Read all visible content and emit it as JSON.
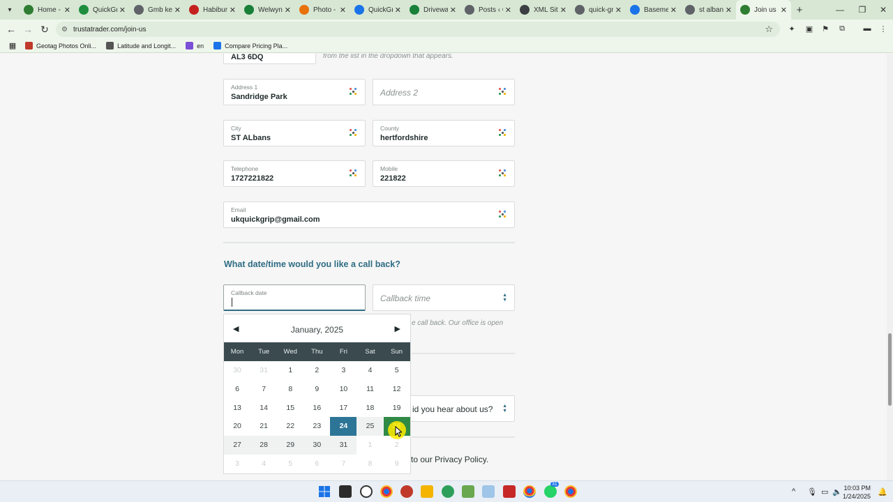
{
  "browser": {
    "tabs": [
      {
        "label": "Home -",
        "color": "#2e7d32"
      },
      {
        "label": "QuickGri",
        "color": "#1e8e3e"
      },
      {
        "label": "Gmb key",
        "color": "#5f6368"
      },
      {
        "label": "Habibur",
        "color": "#c5221f"
      },
      {
        "label": "Welwyn",
        "color": "#188038"
      },
      {
        "label": "Photo -",
        "color": "#e8710a"
      },
      {
        "label": "QuickGri",
        "color": "#1a73e8"
      },
      {
        "label": "Driveway",
        "color": "#188038"
      },
      {
        "label": "Posts ‹ Q",
        "color": "#5f6368"
      },
      {
        "label": "XML Site",
        "color": "#3c4043"
      },
      {
        "label": "quick-gr",
        "color": "#5f6368"
      },
      {
        "label": "Basemen",
        "color": "#1a73e8"
      },
      {
        "label": "st albans",
        "color": "#5f6368"
      },
      {
        "label": "Join us -",
        "color": "#2e7d32",
        "active": true
      }
    ],
    "new_tab": "+",
    "url": "trustatrader.com/join-us",
    "bookmarks": [
      {
        "label": "Geotag Photos Onli...",
        "color": "#c0392b"
      },
      {
        "label": "Latitude and Longit...",
        "color": "#555555"
      },
      {
        "label": "en",
        "color": "#7b4fd6"
      },
      {
        "label": "Compare Pricing Pla...",
        "color": "#1a73e8"
      }
    ]
  },
  "form": {
    "postcode_value": "AL3 6DQ",
    "postcode_hint": "from the list in the dropdown that appears.",
    "address1": {
      "label": "Address 1",
      "value": "Sandridge Park"
    },
    "address2": {
      "placeholder": "Address 2"
    },
    "city": {
      "label": "City",
      "value": "ST ALbans"
    },
    "county": {
      "label": "County",
      "value": "hertfordshire"
    },
    "telephone": {
      "label": "Telephone",
      "value": "1727221822"
    },
    "mobile": {
      "label": "Mobile",
      "value": "221822"
    },
    "email": {
      "label": "Email",
      "value": "ukquickgrip@gmail.com"
    },
    "callback_title": "What date/time would you like a call back?",
    "callback_date": {
      "label": "Callback date",
      "value": ""
    },
    "callback_time": {
      "placeholder": "Callback time"
    },
    "callback_hint": "e call back. Our office is open",
    "hear_about": {
      "placeholder": "id you hear about us?"
    },
    "privacy_text": "to our Privacy Policy."
  },
  "calendar": {
    "month_label": "January, 2025",
    "prev": "◀",
    "next": "▶",
    "weekdays": [
      "Mon",
      "Tue",
      "Wed",
      "Thu",
      "Fri",
      "Sat",
      "Sun"
    ],
    "today": 24,
    "selected": 26,
    "weeks": [
      [
        "30",
        "31",
        "1",
        "2",
        "3",
        "4",
        "5"
      ],
      [
        "6",
        "7",
        "8",
        "9",
        "10",
        "11",
        "12"
      ],
      [
        "13",
        "14",
        "15",
        "16",
        "17",
        "18",
        "19"
      ],
      [
        "20",
        "21",
        "22",
        "23",
        "24",
        "25",
        "26"
      ],
      [
        "27",
        "28",
        "29",
        "30",
        "31",
        "1",
        "2"
      ],
      [
        "3",
        "4",
        "5",
        "6",
        "7",
        "8",
        "9"
      ]
    ]
  },
  "taskbar": {
    "time": "10:03 PM",
    "date": "1/24/2025",
    "badge_mail": "31"
  }
}
